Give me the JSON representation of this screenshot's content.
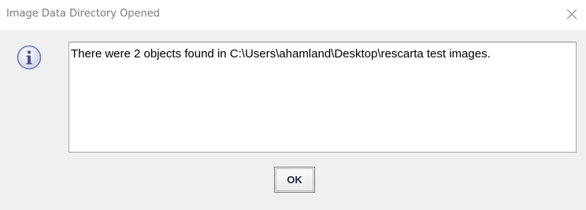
{
  "dialog": {
    "title": "Image Data Directory Opened",
    "close_icon": "close-icon",
    "info_icon": "info-icon",
    "message": "There were 2 objects found in C:\\Users\\ahamland\\Desktop\\rescarta test images.",
    "ok_label": "OK"
  },
  "colors": {
    "title_text": "#7b7b7b",
    "body_background": "#f0f0f0",
    "icon_fill": "#dfe1f4",
    "icon_border": "#6c77ac",
    "icon_glyph": "#4a5590"
  }
}
